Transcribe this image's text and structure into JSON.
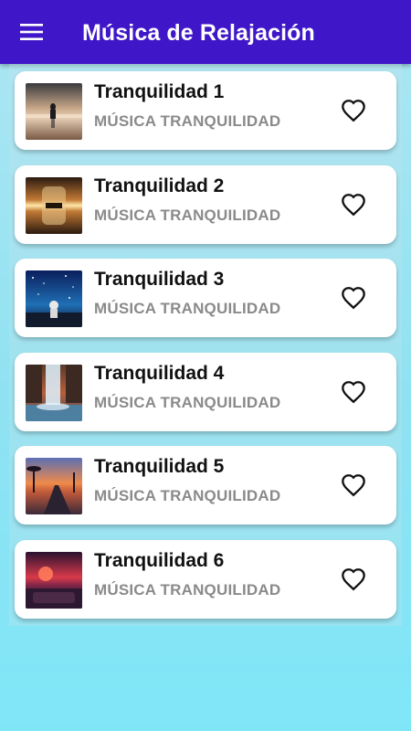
{
  "app": {
    "title": "Música de Relajación",
    "accent_color": "#3f17c8",
    "menu_icon": "hamburger-menu-icon"
  },
  "tracks": [
    {
      "title": "Tranquilidad 1",
      "subtitle": "MÚSICA TRANQUILIDAD",
      "thumbnail": "person-at-beach-sunset",
      "favorite_icon": "heart-outline-icon",
      "favorited": false
    },
    {
      "title": "Tranquilidad 2",
      "subtitle": "MÚSICA TRANQUILIDAD",
      "thumbnail": "reflection-lake-sunset",
      "favorite_icon": "heart-outline-icon",
      "favorited": false
    },
    {
      "title": "Tranquilidad 3",
      "subtitle": "MÚSICA TRANQUILIDAD",
      "thumbnail": "astronaut-starry-night",
      "favorite_icon": "heart-outline-icon",
      "favorited": false
    },
    {
      "title": "Tranquilidad 4",
      "subtitle": "MÚSICA TRANQUILIDAD",
      "thumbnail": "waterfall-sunset",
      "favorite_icon": "heart-outline-icon",
      "favorited": false
    },
    {
      "title": "Tranquilidad 5",
      "subtitle": "MÚSICA TRANQUILIDAD",
      "thumbnail": "palm-road-sunset",
      "favorite_icon": "heart-outline-icon",
      "favorited": false
    },
    {
      "title": "Tranquilidad 6",
      "subtitle": "MÚSICA TRANQUILIDAD",
      "thumbnail": "car-night-drive",
      "favorite_icon": "heart-outline-icon",
      "favorited": false
    }
  ]
}
